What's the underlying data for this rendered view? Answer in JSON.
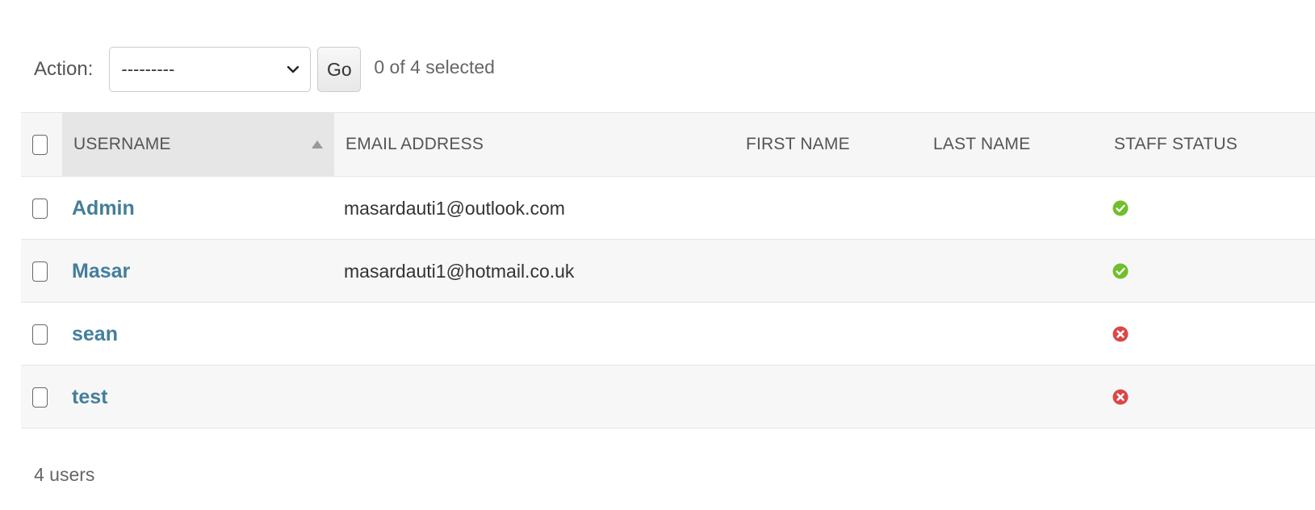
{
  "actions": {
    "label": "Action:",
    "select_value": "---------",
    "go_label": "Go",
    "selected_text": "0 of 4 selected"
  },
  "table": {
    "columns": {
      "username": "Username",
      "email": "Email address",
      "first_name": "First name",
      "last_name": "Last name",
      "staff_status": "Staff status"
    },
    "sorted_column": "username",
    "sort_direction": "ascending",
    "rows": [
      {
        "username": "Admin",
        "email": "masardauti1@outlook.com",
        "first_name": "",
        "last_name": "",
        "staff_status": "yes"
      },
      {
        "username": "Masar",
        "email": "masardauti1@hotmail.co.uk",
        "first_name": "",
        "last_name": "",
        "staff_status": "yes"
      },
      {
        "username": "sean",
        "email": "",
        "first_name": "",
        "last_name": "",
        "staff_status": "no"
      },
      {
        "username": "test",
        "email": "",
        "first_name": "",
        "last_name": "",
        "staff_status": "no"
      }
    ]
  },
  "footer": {
    "count_text": "4 users"
  },
  "colors": {
    "link": "#447e9b",
    "status_yes": "#70bf2b",
    "status_no": "#dd4646"
  }
}
